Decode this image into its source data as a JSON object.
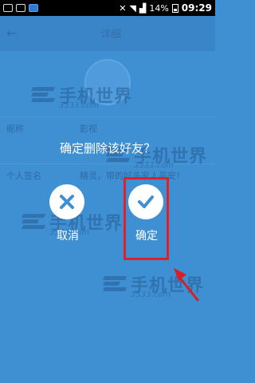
{
  "status_bar": {
    "battery": "14%",
    "time": "09:29"
  },
  "background": {
    "back": "←",
    "title": "详细",
    "rows": [
      {
        "label": "昵称",
        "value": "影视"
      },
      {
        "label": "个人签名",
        "value": "精灵，带的好多家人平安！"
      }
    ]
  },
  "watermark": {
    "text": "手机世界",
    "sub": "3533.com"
  },
  "dialog": {
    "message": "确定删除该好友？",
    "cancel_label": "取消",
    "confirm_label": "确定"
  },
  "colors": {
    "overlay_blue": "#3f8fd3",
    "highlight_red": "#e3202a"
  }
}
